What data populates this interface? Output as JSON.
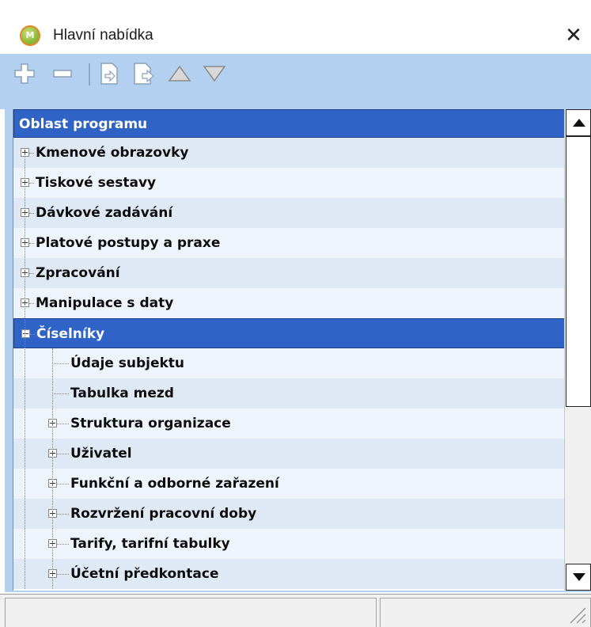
{
  "window": {
    "title": "Hlavní nabídka",
    "close_symbol": "✕"
  },
  "toolbar": {
    "buttons": [
      "add-icon",
      "remove-icon",
      "insert-before-icon",
      "insert-after-icon",
      "move-up-icon",
      "move-down-icon"
    ]
  },
  "tree": {
    "header": "Oblast programu",
    "items": [
      {
        "label": "Kmenové obrazovky",
        "level": 0,
        "expanded": false
      },
      {
        "label": "Tiskové sestavy",
        "level": 0,
        "expanded": false
      },
      {
        "label": "Dávkové zadávání",
        "level": 0,
        "expanded": false
      },
      {
        "label": "Platové postupy a praxe",
        "level": 0,
        "expanded": false
      },
      {
        "label": "Zpracování",
        "level": 0,
        "expanded": false
      },
      {
        "label": "Manipulace s daty",
        "level": 0,
        "expanded": false
      },
      {
        "label": "Číselníky",
        "level": 0,
        "expanded": true,
        "selected": true
      },
      {
        "label": "Údaje subjektu",
        "level": 1,
        "leaf": true
      },
      {
        "label": "Tabulka mezd",
        "level": 1,
        "leaf": true
      },
      {
        "label": "Struktura organizace",
        "level": 1,
        "expanded": false
      },
      {
        "label": "Uživatel",
        "level": 1,
        "expanded": false
      },
      {
        "label": "Funkční a odborné zařazení",
        "level": 1,
        "expanded": false
      },
      {
        "label": "Rozvržení pracovní doby",
        "level": 1,
        "expanded": false
      },
      {
        "label": "Tarify, tarifní tabulky",
        "level": 1,
        "expanded": false
      },
      {
        "label": "Účetní předkontace",
        "level": 1,
        "expanded": false
      }
    ]
  },
  "colors": {
    "selection": "#2f63c6",
    "toolbar_bg": "#b4d0f0",
    "row_alt": "#dfe9f6",
    "row_plain": "#eef4fb"
  }
}
